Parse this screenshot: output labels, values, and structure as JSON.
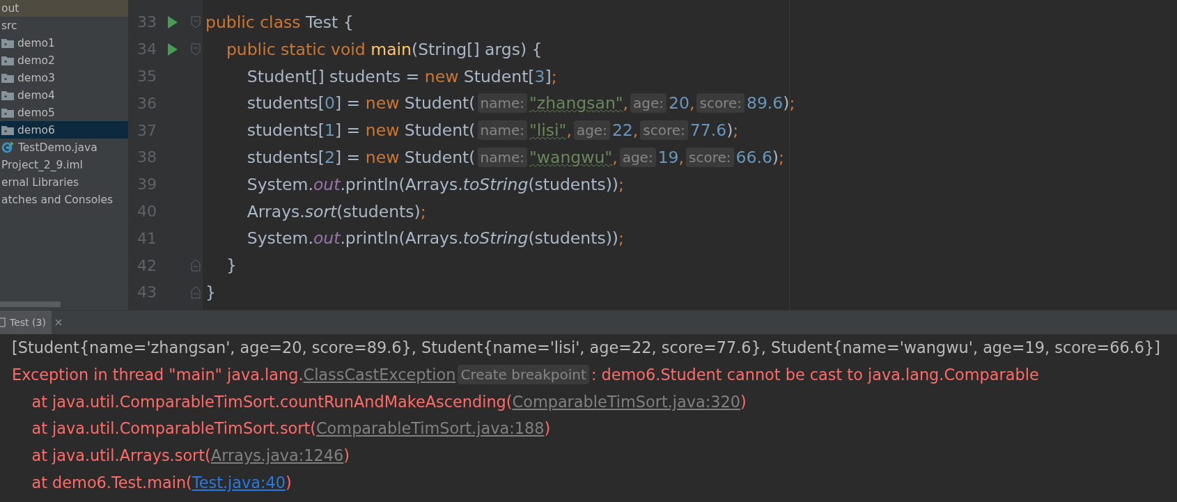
{
  "project_tree": {
    "items": [
      {
        "label": "out",
        "kind": "excluded",
        "selected": false
      },
      {
        "label": "src",
        "kind": "plain",
        "selected": false
      },
      {
        "label": "demo1",
        "kind": "package",
        "selected": false
      },
      {
        "label": "demo2",
        "kind": "package",
        "selected": false
      },
      {
        "label": "demo3",
        "kind": "package",
        "selected": false
      },
      {
        "label": "demo4",
        "kind": "package",
        "selected": false
      },
      {
        "label": "demo5",
        "kind": "package",
        "selected": false
      },
      {
        "label": "demo6",
        "kind": "package",
        "selected": true
      },
      {
        "label": "TestDemo.java",
        "kind": "class",
        "selected": false
      },
      {
        "label": "Project_2_9.iml",
        "kind": "plain",
        "selected": false
      },
      {
        "label": "ernal Libraries",
        "kind": "plain",
        "selected": false
      },
      {
        "label": "atches and Consoles",
        "kind": "plain",
        "selected": false
      }
    ]
  },
  "editor": {
    "lines": [
      {
        "number": "33",
        "run": true,
        "fold_open": true,
        "fold_close": false,
        "tokens": [
          {
            "text": "public class ",
            "kind": "keyword"
          },
          {
            "text": "Test {",
            "kind": "plain"
          }
        ]
      },
      {
        "number": "34",
        "run": true,
        "fold_open": true,
        "fold_close": false,
        "tokens": [
          {
            "text": "    public static void ",
            "kind": "keyword"
          },
          {
            "text": "main",
            "kind": "method"
          },
          {
            "text": "(String[] args) {",
            "kind": "plain"
          }
        ]
      },
      {
        "number": "35",
        "run": false,
        "fold_open": false,
        "fold_close": false,
        "tokens": [
          {
            "text": "        Student[] students = ",
            "kind": "plain"
          },
          {
            "text": "new ",
            "kind": "keyword"
          },
          {
            "text": "Student[",
            "kind": "plain"
          },
          {
            "text": "3",
            "kind": "number"
          },
          {
            "text": "]",
            "kind": "plain"
          },
          {
            "text": ";",
            "kind": "keyword"
          }
        ]
      },
      {
        "number": "36",
        "run": false,
        "fold_open": false,
        "fold_close": false,
        "tokens": [
          {
            "text": "        students[",
            "kind": "plain"
          },
          {
            "text": "0",
            "kind": "number"
          },
          {
            "text": "] = ",
            "kind": "plain"
          },
          {
            "text": "new ",
            "kind": "keyword"
          },
          {
            "text": "Student(",
            "kind": "plain"
          },
          {
            "text": "name:",
            "kind": "hint"
          },
          {
            "text": "\"zhangsan\"",
            "kind": "string_typo"
          },
          {
            "text": ",",
            "kind": "keyword"
          },
          {
            "text": "age:",
            "kind": "hint"
          },
          {
            "text": "20",
            "kind": "number"
          },
          {
            "text": ",",
            "kind": "keyword"
          },
          {
            "text": "score:",
            "kind": "hint"
          },
          {
            "text": "89.6",
            "kind": "number"
          },
          {
            "text": ")",
            "kind": "plain"
          },
          {
            "text": ";",
            "kind": "keyword"
          }
        ]
      },
      {
        "number": "37",
        "run": false,
        "fold_open": false,
        "fold_close": false,
        "tokens": [
          {
            "text": "        students[",
            "kind": "plain"
          },
          {
            "text": "1",
            "kind": "number"
          },
          {
            "text": "] = ",
            "kind": "plain"
          },
          {
            "text": "new ",
            "kind": "keyword"
          },
          {
            "text": "Student(",
            "kind": "plain"
          },
          {
            "text": "name:",
            "kind": "hint"
          },
          {
            "text": "\"lisi\"",
            "kind": "string_typo"
          },
          {
            "text": ",",
            "kind": "keyword"
          },
          {
            "text": "age:",
            "kind": "hint"
          },
          {
            "text": "22",
            "kind": "number"
          },
          {
            "text": ",",
            "kind": "keyword"
          },
          {
            "text": "score:",
            "kind": "hint"
          },
          {
            "text": "77.6",
            "kind": "number"
          },
          {
            "text": ")",
            "kind": "plain"
          },
          {
            "text": ";",
            "kind": "keyword"
          }
        ]
      },
      {
        "number": "38",
        "run": false,
        "fold_open": false,
        "fold_close": false,
        "tokens": [
          {
            "text": "        students[",
            "kind": "plain"
          },
          {
            "text": "2",
            "kind": "number"
          },
          {
            "text": "] = ",
            "kind": "plain"
          },
          {
            "text": "new ",
            "kind": "keyword"
          },
          {
            "text": "Student(",
            "kind": "plain"
          },
          {
            "text": "name:",
            "kind": "hint"
          },
          {
            "text": "\"wangwu\"",
            "kind": "string_typo"
          },
          {
            "text": ",",
            "kind": "keyword"
          },
          {
            "text": "age:",
            "kind": "hint"
          },
          {
            "text": "19",
            "kind": "number"
          },
          {
            "text": ",",
            "kind": "keyword"
          },
          {
            "text": "score:",
            "kind": "hint"
          },
          {
            "text": "66.6",
            "kind": "number"
          },
          {
            "text": ")",
            "kind": "plain"
          },
          {
            "text": ";",
            "kind": "keyword"
          }
        ]
      },
      {
        "number": "39",
        "run": false,
        "fold_open": false,
        "fold_close": false,
        "tokens": [
          {
            "text": "        System.",
            "kind": "plain"
          },
          {
            "text": "out",
            "kind": "static_field"
          },
          {
            "text": ".println(Arrays.",
            "kind": "plain"
          },
          {
            "text": "toString",
            "kind": "static_method"
          },
          {
            "text": "(students))",
            "kind": "plain"
          },
          {
            "text": ";",
            "kind": "keyword"
          }
        ]
      },
      {
        "number": "40",
        "run": false,
        "fold_open": false,
        "fold_close": false,
        "tokens": [
          {
            "text": "        Arrays.",
            "kind": "plain"
          },
          {
            "text": "sort",
            "kind": "static_method"
          },
          {
            "text": "(students)",
            "kind": "plain"
          },
          {
            "text": ";",
            "kind": "keyword"
          }
        ]
      },
      {
        "number": "41",
        "run": false,
        "fold_open": false,
        "fold_close": false,
        "tokens": [
          {
            "text": "        System.",
            "kind": "plain"
          },
          {
            "text": "out",
            "kind": "static_field"
          },
          {
            "text": ".println(Arrays.",
            "kind": "plain"
          },
          {
            "text": "toString",
            "kind": "static_method"
          },
          {
            "text": "(students))",
            "kind": "plain"
          },
          {
            "text": ";",
            "kind": "keyword"
          }
        ]
      },
      {
        "number": "42",
        "run": false,
        "fold_open": false,
        "fold_close": true,
        "tokens": [
          {
            "text": "    }",
            "kind": "plain"
          }
        ]
      },
      {
        "number": "43",
        "run": false,
        "fold_open": false,
        "fold_close": true,
        "tokens": [
          {
            "text": "}",
            "kind": "plain"
          }
        ]
      }
    ]
  },
  "run_panel": {
    "tab": {
      "label": "Test (3)",
      "selected": true
    },
    "lines": [
      {
        "tokens": [
          {
            "text": "[Student{name='zhangsan', age=20, score=89.6}, Student{name='lisi', age=22, score=77.6}, Student{name='wangwu', age=19, score=66.6}]",
            "kind": "output"
          }
        ]
      },
      {
        "tokens": [
          {
            "text": "Exception in thread \"main\" java.lang.",
            "kind": "error"
          },
          {
            "text": "ClassCastException",
            "kind": "link"
          },
          {
            "text": "Create breakpoint",
            "kind": "hint"
          },
          {
            "text": ": demo6.Student cannot be cast to java.lang.Comparable",
            "kind": "error"
          }
        ]
      },
      {
        "tokens": [
          {
            "text": "    at java.util.ComparableTimSort.countRunAndMakeAscending(",
            "kind": "error"
          },
          {
            "text": "ComparableTimSort.java:320",
            "kind": "link"
          },
          {
            "text": ")",
            "kind": "error"
          }
        ]
      },
      {
        "tokens": [
          {
            "text": "    at java.util.ComparableTimSort.sort(",
            "kind": "error"
          },
          {
            "text": "ComparableTimSort.java:188",
            "kind": "link"
          },
          {
            "text": ")",
            "kind": "error"
          }
        ]
      },
      {
        "tokens": [
          {
            "text": "    at java.util.Arrays.sort(",
            "kind": "error"
          },
          {
            "text": "Arrays.java:1246",
            "kind": "link"
          },
          {
            "text": ")",
            "kind": "error"
          }
        ]
      },
      {
        "tokens": [
          {
            "text": "    at demo6.Test.main(",
            "kind": "error"
          },
          {
            "text": "Test.java:40",
            "kind": "source_link"
          },
          {
            "text": ")",
            "kind": "error"
          }
        ]
      }
    ]
  }
}
